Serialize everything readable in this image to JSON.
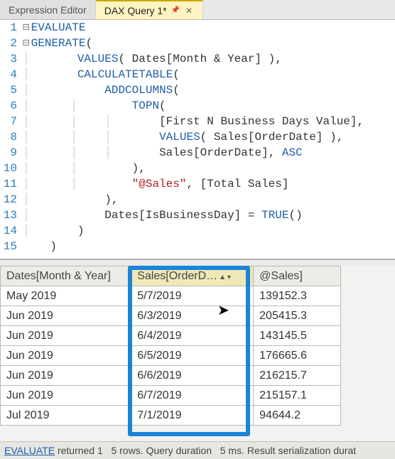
{
  "tabs": {
    "inactive_label": "Expression Editor",
    "active_label": "DAX Query 1*"
  },
  "code": {
    "l1": "EVALUATE",
    "l2a": "GENERATE",
    "l2b": "(",
    "l3a": "VALUES",
    "l3b": "( Dates[Month & Year] ),",
    "l4a": "CALCULATETABLE",
    "l4b": "(",
    "l5a": "ADDCOLUMNS",
    "l5b": "(",
    "l6a": "TOPN",
    "l6b": "(",
    "l7": "[First N Business Days Value],",
    "l8a": "VALUES",
    "l8b": "( Sales[OrderDate] ),",
    "l9a": "Sales[OrderDate], ",
    "l9b": "ASC",
    "l10": "),",
    "l11a": "\"@Sales\"",
    "l11b": ", [Total Sales]",
    "l12": "),",
    "l13a": "Dates[IsBusinessDay] = ",
    "l13b": "TRUE",
    "l13c": "()",
    "l14": ")",
    "l15": ")"
  },
  "grid": {
    "headers": {
      "c1": "Dates[Month & Year]",
      "c2": "Sales[OrderD…",
      "c3": "@Sales]"
    },
    "rows": [
      {
        "m": "May 2019",
        "d": "5/7/2019",
        "s": "139152.3"
      },
      {
        "m": "Jun 2019",
        "d": "6/3/2019",
        "s": "205415.3"
      },
      {
        "m": "Jun 2019",
        "d": "6/4/2019",
        "s": "143145.5"
      },
      {
        "m": "Jun 2019",
        "d": "6/5/2019",
        "s": "176665.6"
      },
      {
        "m": "Jun 2019",
        "d": "6/6/2019",
        "s": "216215.7"
      },
      {
        "m": "Jun 2019",
        "d": "6/7/2019",
        "s": "215157.1"
      },
      {
        "m": "Jul 2019",
        "d": "7/1/2019",
        "s": "94644.2"
      }
    ]
  },
  "status": {
    "link": "EVALUATE",
    "mid1": " returned 1",
    "mid2": "5 rows. Query duration",
    "mid3": "5 ms. Result serialization durat"
  }
}
